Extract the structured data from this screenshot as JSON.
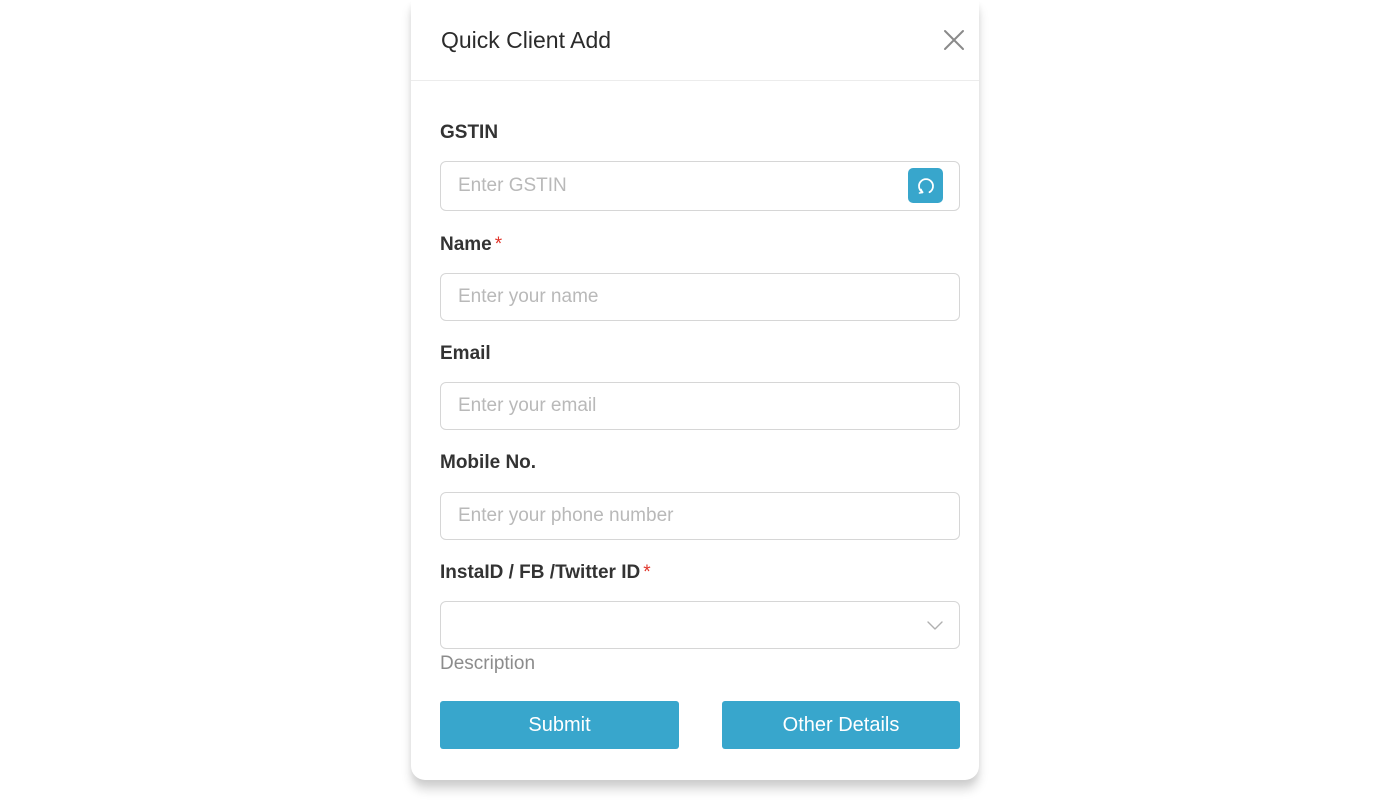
{
  "modal": {
    "title": "Quick Client Add"
  },
  "form": {
    "gstin": {
      "label": "GSTIN",
      "placeholder": "Enter GSTIN",
      "value": ""
    },
    "name": {
      "label": "Name",
      "required_mark": "*",
      "placeholder": "Enter your name",
      "value": ""
    },
    "email": {
      "label": "Email",
      "placeholder": "Enter your email",
      "value": ""
    },
    "mobile": {
      "label": "Mobile No.",
      "placeholder": "Enter your phone number",
      "value": ""
    },
    "social": {
      "label": "InstaID / FB /Twitter ID",
      "required_mark": "*",
      "selected": ""
    },
    "description_label": "Description"
  },
  "buttons": {
    "submit_label": "Submit",
    "other_details_label": "Other Details"
  },
  "icons": {
    "close": "close-icon",
    "refresh": "refresh-icon",
    "dropdown": "chevron-down-icon"
  },
  "colors": {
    "accent": "#38a6cc",
    "required": "#e0352b"
  }
}
